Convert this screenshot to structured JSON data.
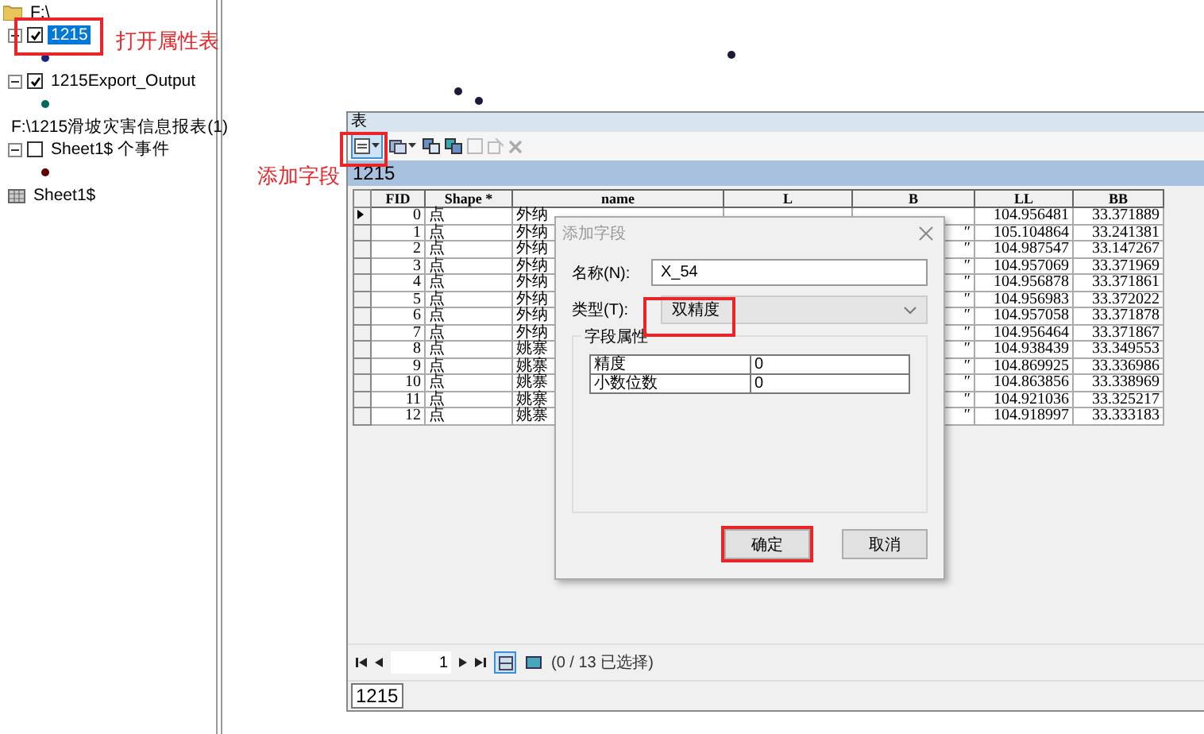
{
  "tree": [
    {
      "label": "F:\\",
      "kind": "folder",
      "children": [
        {
          "label": "1215",
          "kind": "layer",
          "checked": true,
          "selected": true,
          "expanded": true,
          "color": "#1a237e"
        },
        {
          "label": "1215Export_Output",
          "kind": "layer",
          "checked": true,
          "selected": false,
          "expanded": true,
          "color": "#00695c"
        }
      ]
    },
    {
      "label": "F:\\1215滑坡灾害信息报表(1)",
      "kind": "folder",
      "children": [
        {
          "label": "Sheet1$ 个事件",
          "kind": "layer",
          "checked": false,
          "selected": false,
          "expanded": true,
          "color": "#5d0000"
        },
        {
          "label": "Sheet1$",
          "kind": "table",
          "selected": false
        }
      ]
    }
  ],
  "annotations": [
    {
      "text": "打开属性表"
    },
    {
      "text": "添加字段"
    }
  ],
  "table_window": {
    "title": "表",
    "table_name": "1215",
    "columns": [
      "FID",
      "Shape *",
      "name",
      "L",
      "B",
      "LL",
      "BB"
    ],
    "rows": [
      {
        "fid": "0",
        "shape": "点",
        "name": "外纳",
        "b": "",
        "ll": "104.956481",
        "bb": "33.371889",
        "current": true
      },
      {
        "fid": "1",
        "shape": "点",
        "name": "外纳",
        "b": "″",
        "ll": "105.104864",
        "bb": "33.241381",
        "current": false
      },
      {
        "fid": "2",
        "shape": "点",
        "name": "外纳",
        "b": "″",
        "ll": "104.987547",
        "bb": "33.147267",
        "current": false
      },
      {
        "fid": "3",
        "shape": "点",
        "name": "外纳",
        "b": "″",
        "ll": "104.957069",
        "bb": "33.371969",
        "current": false
      },
      {
        "fid": "4",
        "shape": "点",
        "name": "外纳",
        "b": "″",
        "ll": "104.956878",
        "bb": "33.371861",
        "current": false
      },
      {
        "fid": "5",
        "shape": "点",
        "name": "外纳",
        "b": "″",
        "ll": "104.956983",
        "bb": "33.372022",
        "current": false
      },
      {
        "fid": "6",
        "shape": "点",
        "name": "外纳",
        "b": "″",
        "ll": "104.957058",
        "bb": "33.371878",
        "current": false
      },
      {
        "fid": "7",
        "shape": "点",
        "name": "外纳",
        "b": "″",
        "ll": "104.956464",
        "bb": "33.371867",
        "current": false
      },
      {
        "fid": "8",
        "shape": "点",
        "name": "姚寨",
        "b": "″",
        "ll": "104.938439",
        "bb": "33.349553",
        "current": false
      },
      {
        "fid": "9",
        "shape": "点",
        "name": "姚寨",
        "b": "″",
        "ll": "104.869925",
        "bb": "33.336986",
        "current": false
      },
      {
        "fid": "10",
        "shape": "点",
        "name": "姚寨",
        "b": "″",
        "ll": "104.863856",
        "bb": "33.338969",
        "current": false
      },
      {
        "fid": "11",
        "shape": "点",
        "name": "姚寨",
        "b": "″",
        "ll": "104.921036",
        "bb": "33.325217",
        "current": false
      },
      {
        "fid": "12",
        "shape": "点",
        "name": "姚寨",
        "b": "″",
        "ll": "104.918997",
        "bb": "33.333183",
        "current": false
      }
    ],
    "nav": {
      "record": "1",
      "status": "(0 / 13 已选择)"
    },
    "tab": "1215"
  },
  "dialog": {
    "title": "添加字段",
    "name_label": "名称(N):",
    "name_value": "X_54",
    "type_label": "类型(T):",
    "type_value": "双精度",
    "group_title": "字段属性",
    "properties": [
      {
        "name": "精度",
        "value": "0"
      },
      {
        "name": "小数位数",
        "value": "0"
      }
    ],
    "buttons": [
      "确定",
      "取消"
    ]
  }
}
